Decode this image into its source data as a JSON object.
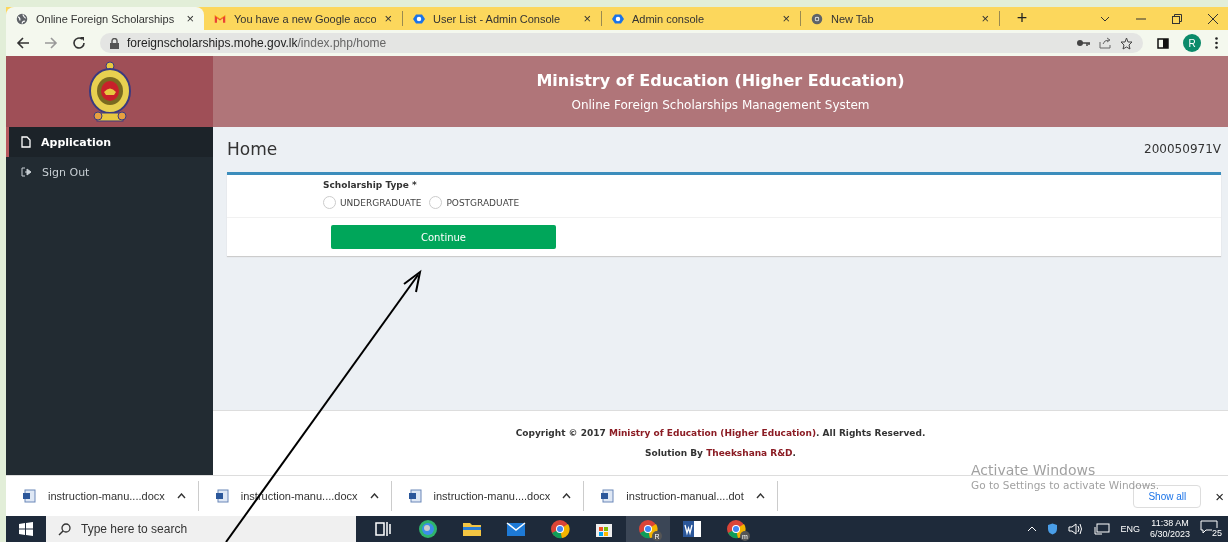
{
  "browser": {
    "tabs": [
      {
        "title": "Online Foreign Scholarships",
        "kind": "globe",
        "close": "×",
        "selected": true
      },
      {
        "title": "You have a new Google acco",
        "kind": "mail",
        "close": "×",
        "selected": false
      },
      {
        "title": "User List - Admin Console",
        "kind": "hex",
        "close": "×",
        "selected": false
      },
      {
        "title": "Admin console",
        "kind": "hex",
        "close": "×",
        "selected": false
      },
      {
        "title": "New Tab",
        "kind": "chrome",
        "close": "×",
        "selected": false
      }
    ],
    "new_tab": "+",
    "url_domain": "foreignscholarships.mohe.gov.lk",
    "url_path": "/index.php/home",
    "profile": "R"
  },
  "header": {
    "title": "Ministry of Education (Higher Education)",
    "subtitle": "Online Foreign Scholarships Management System"
  },
  "sidebar": {
    "items": [
      {
        "label": "Application",
        "kind": "page",
        "selected": true
      },
      {
        "label": "Sign Out",
        "kind": "signout",
        "selected": false
      }
    ]
  },
  "page": {
    "title": "Home",
    "user_id": "200050971V",
    "form": {
      "label": "Scholarship Type *",
      "options": [
        {
          "label": "UNDERGRADUATE",
          "selected": false
        },
        {
          "label": "POSTGRADUATE",
          "selected": false
        }
      ],
      "button": "Continue"
    }
  },
  "footer": {
    "copyright_prefix": "Copyright © 2017 ",
    "copyright_link": "Ministry of Education (Higher Education)",
    "copyright_suffix": ". All Rights Reserved.",
    "solution_prefix": "Solution By ",
    "solution_link": "Theekshana R&D",
    "solution_suffix": "."
  },
  "downloads": {
    "items": [
      {
        "filename": "instruction-manu....docx"
      },
      {
        "filename": "instruction-manu....docx"
      },
      {
        "filename": "instruction-manu....docx"
      },
      {
        "filename": "instruction-manual....dot"
      }
    ],
    "show_all": "Show all",
    "close": "×"
  },
  "activation": {
    "title": "Activate Windows",
    "message": "Go to Settings to activate Windows."
  },
  "taskbar": {
    "search_placeholder": "Type here to search",
    "apps": [
      {
        "kind": "taskview",
        "selected": false
      },
      {
        "kind": "edge",
        "selected": false
      },
      {
        "kind": "folder",
        "selected": false
      },
      {
        "kind": "mail",
        "selected": false
      },
      {
        "kind": "chrome",
        "selected": false
      },
      {
        "kind": "store",
        "selected": false
      },
      {
        "kind": "chrome",
        "badge": "R",
        "selected": true
      },
      {
        "kind": "word",
        "selected": false
      },
      {
        "kind": "chrome",
        "badge": "m",
        "selected": false
      }
    ],
    "language": "ENG",
    "time": "11:38 AM",
    "date": "6/30/2023",
    "notifications": "25"
  }
}
